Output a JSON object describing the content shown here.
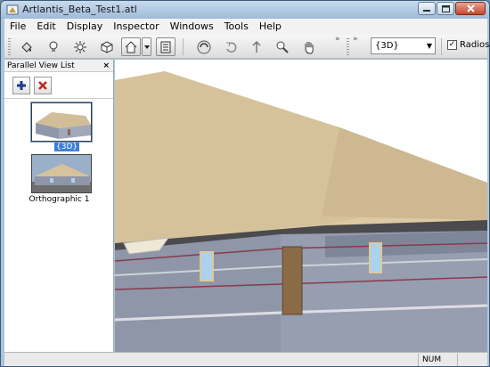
{
  "window": {
    "title": "Artlantis_Beta_Test1.atl"
  },
  "menu": [
    "File",
    "Edit",
    "Display",
    "Inspector",
    "Windows",
    "Tools",
    "Help"
  ],
  "toolbar": {
    "view_select_value": "{3D}",
    "radiosity_label": "Radiosity",
    "radiosity_checked": "✓"
  },
  "panel": {
    "title": "Parallel View List",
    "close_glyph": "×",
    "views": [
      {
        "label": "{3D}",
        "selected": true
      },
      {
        "label": "Orthographic 1",
        "selected": false
      }
    ]
  },
  "status": {
    "num": "NUM"
  },
  "colors": {
    "roof": "#d9c6a0",
    "wall": "#8e96a8",
    "door": "#8b6a46",
    "window_glass": "#a9d3ee",
    "selection": "#3d7fd8"
  }
}
